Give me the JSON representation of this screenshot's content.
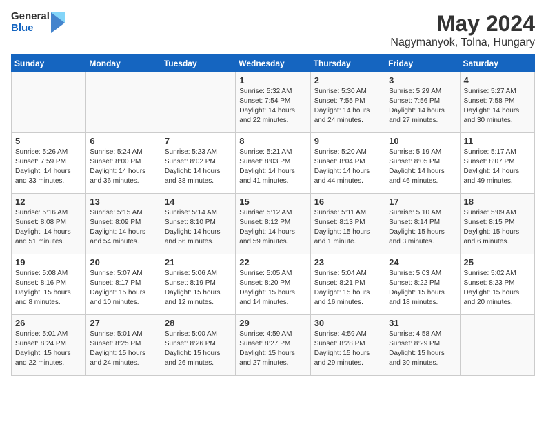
{
  "header": {
    "logo_general": "General",
    "logo_blue": "Blue",
    "title": "May 2024",
    "subtitle": "Nagymanyok, Tolna, Hungary"
  },
  "days_of_week": [
    "Sunday",
    "Monday",
    "Tuesday",
    "Wednesday",
    "Thursday",
    "Friday",
    "Saturday"
  ],
  "weeks": [
    [
      {
        "day": "",
        "content": ""
      },
      {
        "day": "",
        "content": ""
      },
      {
        "day": "",
        "content": ""
      },
      {
        "day": "1",
        "content": "Sunrise: 5:32 AM\nSunset: 7:54 PM\nDaylight: 14 hours\nand 22 minutes."
      },
      {
        "day": "2",
        "content": "Sunrise: 5:30 AM\nSunset: 7:55 PM\nDaylight: 14 hours\nand 24 minutes."
      },
      {
        "day": "3",
        "content": "Sunrise: 5:29 AM\nSunset: 7:56 PM\nDaylight: 14 hours\nand 27 minutes."
      },
      {
        "day": "4",
        "content": "Sunrise: 5:27 AM\nSunset: 7:58 PM\nDaylight: 14 hours\nand 30 minutes."
      }
    ],
    [
      {
        "day": "5",
        "content": "Sunrise: 5:26 AM\nSunset: 7:59 PM\nDaylight: 14 hours\nand 33 minutes."
      },
      {
        "day": "6",
        "content": "Sunrise: 5:24 AM\nSunset: 8:00 PM\nDaylight: 14 hours\nand 36 minutes."
      },
      {
        "day": "7",
        "content": "Sunrise: 5:23 AM\nSunset: 8:02 PM\nDaylight: 14 hours\nand 38 minutes."
      },
      {
        "day": "8",
        "content": "Sunrise: 5:21 AM\nSunset: 8:03 PM\nDaylight: 14 hours\nand 41 minutes."
      },
      {
        "day": "9",
        "content": "Sunrise: 5:20 AM\nSunset: 8:04 PM\nDaylight: 14 hours\nand 44 minutes."
      },
      {
        "day": "10",
        "content": "Sunrise: 5:19 AM\nSunset: 8:05 PM\nDaylight: 14 hours\nand 46 minutes."
      },
      {
        "day": "11",
        "content": "Sunrise: 5:17 AM\nSunset: 8:07 PM\nDaylight: 14 hours\nand 49 minutes."
      }
    ],
    [
      {
        "day": "12",
        "content": "Sunrise: 5:16 AM\nSunset: 8:08 PM\nDaylight: 14 hours\nand 51 minutes."
      },
      {
        "day": "13",
        "content": "Sunrise: 5:15 AM\nSunset: 8:09 PM\nDaylight: 14 hours\nand 54 minutes."
      },
      {
        "day": "14",
        "content": "Sunrise: 5:14 AM\nSunset: 8:10 PM\nDaylight: 14 hours\nand 56 minutes."
      },
      {
        "day": "15",
        "content": "Sunrise: 5:12 AM\nSunset: 8:12 PM\nDaylight: 14 hours\nand 59 minutes."
      },
      {
        "day": "16",
        "content": "Sunrise: 5:11 AM\nSunset: 8:13 PM\nDaylight: 15 hours\nand 1 minute."
      },
      {
        "day": "17",
        "content": "Sunrise: 5:10 AM\nSunset: 8:14 PM\nDaylight: 15 hours\nand 3 minutes."
      },
      {
        "day": "18",
        "content": "Sunrise: 5:09 AM\nSunset: 8:15 PM\nDaylight: 15 hours\nand 6 minutes."
      }
    ],
    [
      {
        "day": "19",
        "content": "Sunrise: 5:08 AM\nSunset: 8:16 PM\nDaylight: 15 hours\nand 8 minutes."
      },
      {
        "day": "20",
        "content": "Sunrise: 5:07 AM\nSunset: 8:17 PM\nDaylight: 15 hours\nand 10 minutes."
      },
      {
        "day": "21",
        "content": "Sunrise: 5:06 AM\nSunset: 8:19 PM\nDaylight: 15 hours\nand 12 minutes."
      },
      {
        "day": "22",
        "content": "Sunrise: 5:05 AM\nSunset: 8:20 PM\nDaylight: 15 hours\nand 14 minutes."
      },
      {
        "day": "23",
        "content": "Sunrise: 5:04 AM\nSunset: 8:21 PM\nDaylight: 15 hours\nand 16 minutes."
      },
      {
        "day": "24",
        "content": "Sunrise: 5:03 AM\nSunset: 8:22 PM\nDaylight: 15 hours\nand 18 minutes."
      },
      {
        "day": "25",
        "content": "Sunrise: 5:02 AM\nSunset: 8:23 PM\nDaylight: 15 hours\nand 20 minutes."
      }
    ],
    [
      {
        "day": "26",
        "content": "Sunrise: 5:01 AM\nSunset: 8:24 PM\nDaylight: 15 hours\nand 22 minutes."
      },
      {
        "day": "27",
        "content": "Sunrise: 5:01 AM\nSunset: 8:25 PM\nDaylight: 15 hours\nand 24 minutes."
      },
      {
        "day": "28",
        "content": "Sunrise: 5:00 AM\nSunset: 8:26 PM\nDaylight: 15 hours\nand 26 minutes."
      },
      {
        "day": "29",
        "content": "Sunrise: 4:59 AM\nSunset: 8:27 PM\nDaylight: 15 hours\nand 27 minutes."
      },
      {
        "day": "30",
        "content": "Sunrise: 4:59 AM\nSunset: 8:28 PM\nDaylight: 15 hours\nand 29 minutes."
      },
      {
        "day": "31",
        "content": "Sunrise: 4:58 AM\nSunset: 8:29 PM\nDaylight: 15 hours\nand 30 minutes."
      },
      {
        "day": "",
        "content": ""
      }
    ]
  ]
}
